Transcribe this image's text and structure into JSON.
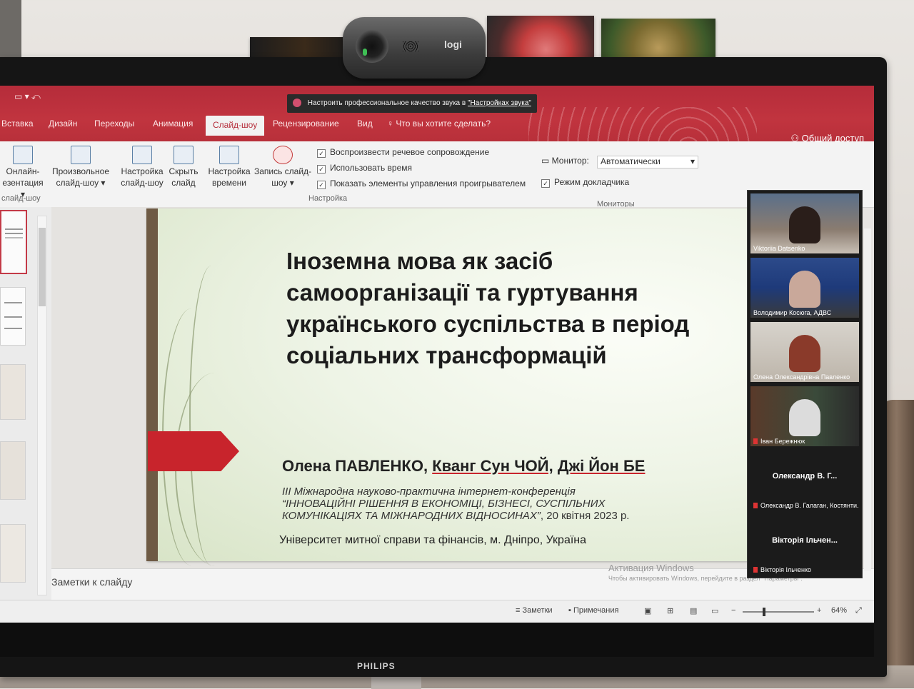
{
  "webcam": {
    "brand": "logi"
  },
  "monitor": {
    "brand": "PHILIPS"
  },
  "powerpoint": {
    "notification": {
      "text": "Настроить профессиональное качество звука в",
      "link": "\"Настройках звука\""
    },
    "tabs": [
      "Вставка",
      "Дизайн",
      "Переходы",
      "Анимация",
      "Слайд-шоу",
      "Рецензирование",
      "Вид"
    ],
    "active_tab": "Слайд-шоу",
    "tell_me": "Что вы хотите сделать?",
    "share": "Общий доступ",
    "ribbon": {
      "online_presentation": [
        "Онлайн-",
        "езентация"
      ],
      "custom_show": [
        "Произвольное",
        "слайд-шоу"
      ],
      "setup_show": [
        "Настройка",
        "слайд-шоу"
      ],
      "hide_slide": [
        "Скрыть",
        "слайд"
      ],
      "rehearse": [
        "Настройка",
        "времени"
      ],
      "record": [
        "Запись слайд-",
        "шоу"
      ],
      "group_left": "слайд-шоу",
      "checkboxes": [
        "Воспроизвести речевое сопровождение",
        "Использовать время",
        "Показать элементы управления проигрывателем"
      ],
      "group_setup": "Настройка",
      "monitor_label": "Монитор:",
      "monitor_value": "Автоматически",
      "presenter_view": "Режим докладчика",
      "group_monitors": "Мониторы"
    },
    "slide": {
      "title": "Іноземна мова як засіб самоорганізації та гуртування українського суспільства в період соціальних трансформацій",
      "author1": "Олена ПАВЛЕНКО,",
      "author2": "Кванг Сун ЧОЙ,",
      "author3": "Джі Йон БЕ",
      "conf_line1": "ІІІ Міжнародна науково-практична інтернет-конференція",
      "conf_line2": "“ІННОВАЦІЙНІ РІШЕННЯ В ЕКОНОМІЦІ, БІЗНЕСІ, СУСПІЛЬНИХ",
      "conf_line3": "КОМУНІКАЦІЯХ ТА МІЖНАРОДНИХ ВІДНОСИНАХ”",
      "conf_date": ", 20 квітня 2023 р.",
      "university": "Університет митної справи та фінансів, м. Дніпро, Україна"
    },
    "notes_placeholder": "Заметки к слайду",
    "activation": {
      "title": "Активация Windows",
      "text": "Чтобы активировать Windows, перейдите в раздел \"Параметры\"."
    },
    "status": {
      "notes": "Заметки",
      "comments": "Примечания",
      "zoom": "64%"
    }
  },
  "video_call": {
    "participants": [
      {
        "name": "Viktoriia Datsenko",
        "video": true,
        "muted": false
      },
      {
        "name": "Володимир Косюга, АДВС",
        "video": true,
        "muted": false
      },
      {
        "name": "Олена Олександрівна Павленко",
        "video": true,
        "muted": false
      },
      {
        "name": "Іван Бережнюк",
        "video": true,
        "muted": true
      },
      {
        "name": "Олександр В. Галаган, Костянти...",
        "short": "Олександр В. Г...",
        "video": false,
        "muted": true
      },
      {
        "name": "Вікторія Ільченко",
        "short": "Вікторія Ільчен...",
        "video": false,
        "muted": true
      }
    ]
  }
}
